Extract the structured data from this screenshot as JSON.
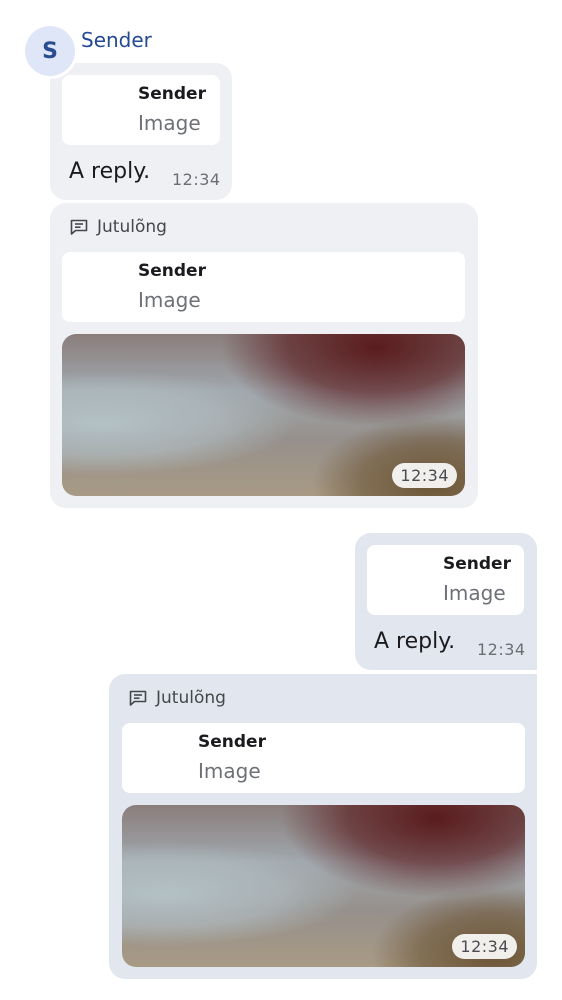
{
  "sender": {
    "initial": "S",
    "name": "Sender"
  },
  "messages": [
    {
      "quote_sender": "Sender",
      "quote_type": "Image",
      "text": "A reply.",
      "time": "12:34"
    },
    {
      "thread_label": "Jutulõng",
      "quote_sender": "Sender",
      "quote_type": "Image",
      "time": "12:34"
    },
    {
      "quote_sender": "Sender",
      "quote_type": "Image",
      "text": "A reply.",
      "time": "12:34"
    },
    {
      "thread_label": "Jutulõng",
      "quote_sender": "Sender",
      "quote_type": "Image",
      "time": "12:34"
    }
  ],
  "icons": {
    "thread": "thread-icon"
  },
  "colors": {
    "incoming_bubble": "#eff0f3",
    "outgoing_bubble": "#e2e6ee",
    "sender_name": "#234a93",
    "avatar_bg": "#dfe6f7"
  }
}
